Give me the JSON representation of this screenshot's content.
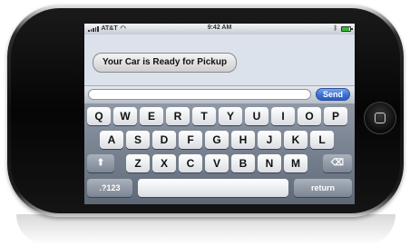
{
  "status_bar": {
    "carrier": "AT&T",
    "time": "9:42 AM",
    "wifi_icon": "wifi-icon",
    "bluetooth_icon": "bluetooth-icon",
    "battery_level": 0.85,
    "battery_color": "#3bb53b"
  },
  "messages": [
    {
      "text": "Your Car is Ready for Pickup",
      "from": "incoming"
    }
  ],
  "compose": {
    "value": "",
    "send_label": "Send"
  },
  "keyboard": {
    "row1": [
      "Q",
      "W",
      "E",
      "R",
      "T",
      "Y",
      "U",
      "I",
      "O",
      "P"
    ],
    "row2": [
      "A",
      "S",
      "D",
      "F",
      "G",
      "H",
      "J",
      "K",
      "L"
    ],
    "row3": [
      "Z",
      "X",
      "C",
      "V",
      "B",
      "N",
      "M"
    ],
    "shift_glyph": "⬆",
    "backspace_glyph": "⌫",
    "numbers_label": ".?123",
    "space_label": "",
    "return_label": "return"
  },
  "colors": {
    "send_button": "#3b6fd1",
    "screen_background": "#dbe2ec"
  }
}
